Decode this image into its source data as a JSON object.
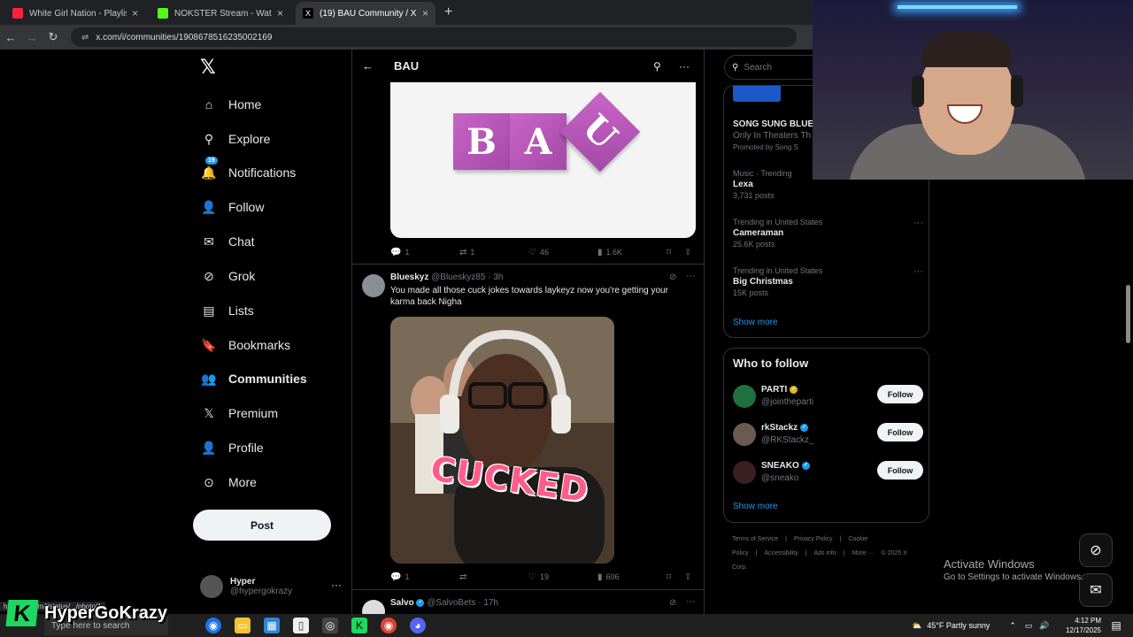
{
  "browser": {
    "tabs": [
      {
        "label": "White Girl Nation - Playlist - Ap",
        "favicon_color": "#fa233b"
      },
      {
        "label": "NOKSTER Stream - Watch Live",
        "favicon_color": "#53fc18"
      },
      {
        "label": "(19) BAU Community / X",
        "favicon_color": "#000000"
      }
    ],
    "new_tab": "+",
    "close": "×",
    "url": "x.com/i/communities/1908678516235002169",
    "back": "←",
    "forward": "→",
    "reload": "↻",
    "site_icon": "⇌"
  },
  "nav": {
    "logo": "𝕏",
    "items": [
      {
        "label": "Home",
        "icon": "home-icon",
        "glyph": "⌂"
      },
      {
        "label": "Explore",
        "icon": "search-icon",
        "glyph": "⚲"
      },
      {
        "label": "Notifications",
        "icon": "bell-icon",
        "glyph": "🔔",
        "badge": "19"
      },
      {
        "label": "Follow",
        "icon": "follow-icon",
        "glyph": "👤"
      },
      {
        "label": "Chat",
        "icon": "mail-icon",
        "glyph": "✉"
      },
      {
        "label": "Grok",
        "icon": "grok-icon",
        "glyph": "⊘"
      },
      {
        "label": "Lists",
        "icon": "list-icon",
        "glyph": "▤"
      },
      {
        "label": "Bookmarks",
        "icon": "bookmark-icon",
        "glyph": "🔖"
      },
      {
        "label": "Communities",
        "icon": "communities-icon",
        "glyph": "👥"
      },
      {
        "label": "Premium",
        "icon": "x-icon",
        "glyph": "𝕏"
      },
      {
        "label": "Profile",
        "icon": "profile-icon",
        "glyph": "👤"
      },
      {
        "label": "More",
        "icon": "more-circle-icon",
        "glyph": "⊙"
      }
    ],
    "post_button": "Post",
    "account": {
      "name": "Hyper",
      "handle": "@hypergokrazy",
      "more": "···"
    }
  },
  "main": {
    "header": {
      "title": "BAU",
      "back": "←",
      "search": "⚲",
      "more": "···"
    },
    "blocks": [
      "B",
      "A",
      "U"
    ],
    "first_post_actions": {
      "replies": "1",
      "reposts": "1",
      "likes": "46",
      "views": "1.6K"
    },
    "post2": {
      "name": "Blueskyz",
      "handle": "@Blueskyz85 · 3h",
      "text": "You made all those cuck jokes towards laykeyz now you're getting your karma back Nigha",
      "image_caption": "CUCKED",
      "actions": {
        "replies": "1",
        "reposts": "",
        "likes": "19",
        "views": "606"
      }
    },
    "post3": {
      "name": "Salvo",
      "handle": "@SalvoBets · 17h"
    }
  },
  "right": {
    "search_placeholder": "Search",
    "promo": {
      "title": "SONG SUNG BLUE",
      "sub": "Only In Theaters Th",
      "promoted": "Promoted by Song S"
    },
    "trends": [
      {
        "context": "Music · Trending",
        "name": "Lexa",
        "count": "3,731 posts"
      },
      {
        "context": "Trending in United States",
        "name": "Cameraman",
        "count": "25.6K posts"
      },
      {
        "context": "Trending in United States",
        "name": "Big Christmas",
        "count": "15K posts"
      }
    ],
    "show_more": "Show more",
    "who_to_follow": {
      "title": "Who to follow",
      "people": [
        {
          "name": "PARTI",
          "handle": "@jointheparti",
          "badge": "gold",
          "follow": "Follow"
        },
        {
          "name": "rkStackz",
          "handle": "@RKStackz_",
          "badge": "blue",
          "follow": "Follow"
        },
        {
          "name": "SNEAKO",
          "handle": "@sneako",
          "badge": "blue",
          "follow": "Follow"
        }
      ],
      "show_more": "Show more"
    },
    "footer": [
      "Terms of Service",
      "|",
      "Privacy Policy",
      "|",
      "Cookie Policy",
      "|",
      "Accessibility",
      "|",
      "Ads info",
      "|",
      "More ···",
      "© 2025 X Corp."
    ]
  },
  "overlay": {
    "activate_title": "Activate Windows",
    "activate_sub": "Go to Settings to activate Windows.",
    "brand_letter": "K",
    "brand_name": "HyperGoKrazy",
    "status_url": "https://x.com/i/status/.../photo/1"
  },
  "taskbar": {
    "search_placeholder": "Type here to search",
    "weather": "45°F  Partly sunny",
    "time": "4:12 PM",
    "date": "12/17/2025"
  }
}
